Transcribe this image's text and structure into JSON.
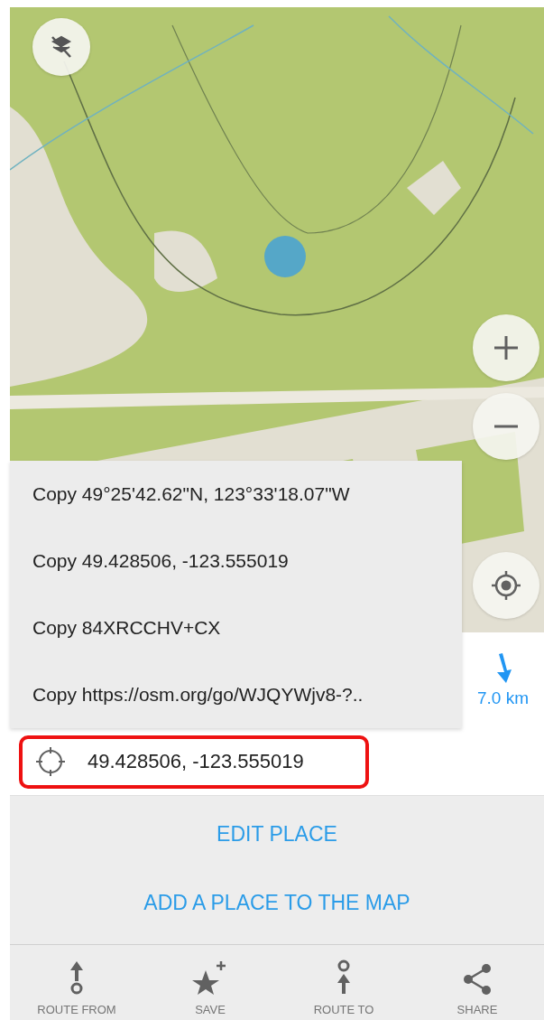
{
  "copy_menu": [
    {
      "label": "Copy 49°25'42.62\"N, 123°33'18.07\"W"
    },
    {
      "label": "Copy 49.428506, -123.555019"
    },
    {
      "label": "Copy 84XRCCHV+CX"
    },
    {
      "label": "Copy https://osm.org/go/WJQYWjv8-?.."
    }
  ],
  "distance": {
    "value": "7.0 km"
  },
  "coordinates": {
    "value": "49.428506, -123.555019",
    "highlighted": true
  },
  "actions": [
    {
      "label": "EDIT PLACE"
    },
    {
      "label": "ADD A PLACE TO THE MAP"
    }
  ],
  "bottom_bar": [
    {
      "label": "ROUTE FROM",
      "kind": "route-from"
    },
    {
      "label": "SAVE",
      "kind": "save"
    },
    {
      "label": "ROUTE TO",
      "kind": "route-to"
    },
    {
      "label": "SHARE",
      "kind": "share"
    }
  ]
}
